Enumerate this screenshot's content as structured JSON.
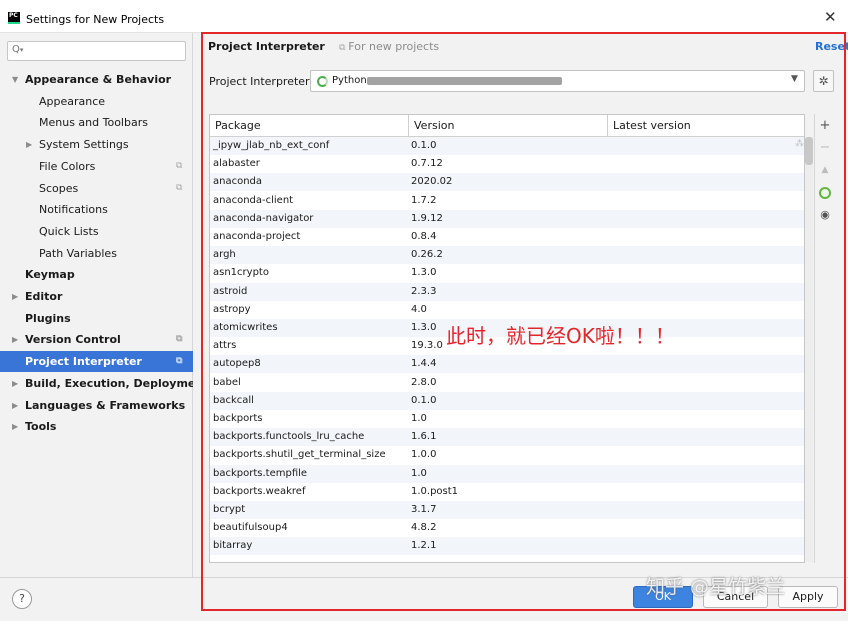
{
  "window": {
    "app_icon_text": "PC",
    "title": "Settings for New Projects",
    "close_glyph": "✕"
  },
  "sidebar": {
    "search_placeholder": "",
    "search_icon": "search-icon",
    "items": [
      {
        "label": "Appearance & Behavior",
        "bold": true,
        "arrow": "▼"
      },
      {
        "label": "Appearance"
      },
      {
        "label": "Menus and Toolbars"
      },
      {
        "label": "System Settings",
        "arrow": "▶"
      },
      {
        "label": "File Colors"
      },
      {
        "label": "Scopes"
      },
      {
        "label": "Notifications"
      },
      {
        "label": "Quick Lists"
      },
      {
        "label": "Path Variables"
      },
      {
        "label": "Keymap",
        "bold": true
      },
      {
        "label": "Editor",
        "bold": true,
        "arrow": "▶"
      },
      {
        "label": "Plugins",
        "bold": true
      },
      {
        "label": "Version Control",
        "bold": true,
        "arrow": "▶"
      },
      {
        "label": "Project Interpreter",
        "bold": true,
        "selected": true
      },
      {
        "label": "Build, Execution, Deployment",
        "bold": true,
        "arrow": "▶"
      },
      {
        "label": "Languages & Frameworks",
        "bold": true,
        "arrow": "▶"
      },
      {
        "label": "Tools",
        "bold": true,
        "arrow": "▶"
      }
    ]
  },
  "header": {
    "title": "Project Interpreter",
    "scope_note": "For new projects",
    "reset": "Reset"
  },
  "interpreter": {
    "label": "Project Interpreter:",
    "value": "Python"
  },
  "table": {
    "columns": [
      "Package",
      "Version",
      "Latest version"
    ],
    "rows": [
      [
        "_ipyw_jlab_nb_ext_conf",
        "0.1.0",
        ""
      ],
      [
        "alabaster",
        "0.7.12",
        ""
      ],
      [
        "anaconda",
        "2020.02",
        ""
      ],
      [
        "anaconda-client",
        "1.7.2",
        ""
      ],
      [
        "anaconda-navigator",
        "1.9.12",
        ""
      ],
      [
        "anaconda-project",
        "0.8.4",
        ""
      ],
      [
        "argh",
        "0.26.2",
        ""
      ],
      [
        "asn1crypto",
        "1.3.0",
        ""
      ],
      [
        "astroid",
        "2.3.3",
        ""
      ],
      [
        "astropy",
        "4.0",
        ""
      ],
      [
        "atomicwrites",
        "1.3.0",
        ""
      ],
      [
        "attrs",
        "19.3.0",
        ""
      ],
      [
        "autopep8",
        "1.4.4",
        ""
      ],
      [
        "babel",
        "2.8.0",
        ""
      ],
      [
        "backcall",
        "0.1.0",
        ""
      ],
      [
        "backports",
        "1.0",
        ""
      ],
      [
        "backports.functools_lru_cache",
        "1.6.1",
        ""
      ],
      [
        "backports.shutil_get_terminal_size",
        "1.0.0",
        ""
      ],
      [
        "backports.tempfile",
        "1.0",
        ""
      ],
      [
        "backports.weakref",
        "1.0.post1",
        ""
      ],
      [
        "bcrypt",
        "3.1.7",
        ""
      ],
      [
        "beautifulsoup4",
        "4.8.2",
        ""
      ],
      [
        "bitarray",
        "1.2.1",
        ""
      ]
    ]
  },
  "tools": {
    "add": "+",
    "remove": "−",
    "upgrade": "▲",
    "eye": "◉"
  },
  "annotation": "此时，就已经OK啦！！！",
  "footer": {
    "help": "?",
    "ok": "OK",
    "cancel": "Cancel",
    "apply": "Apply",
    "watermark": "知乎 @星竹紫兰"
  },
  "colors": {
    "accent": "#3875d7",
    "annotation_red": "#e3262b",
    "link": "#2470d1"
  }
}
